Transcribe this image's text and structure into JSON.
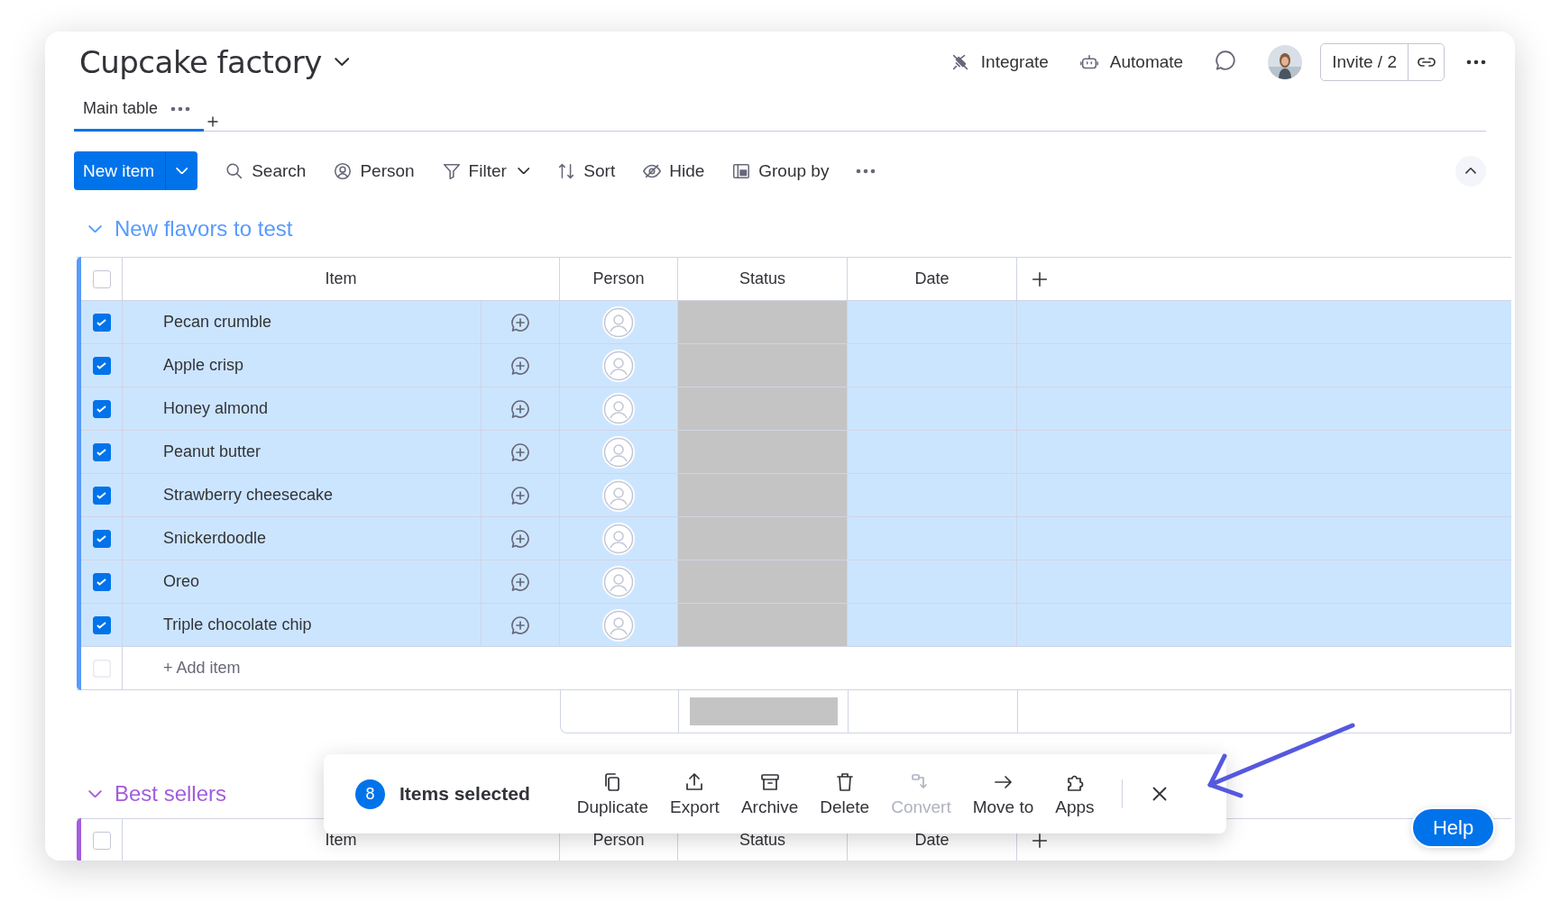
{
  "board": {
    "title": "Cupcake factory"
  },
  "header_actions": [
    {
      "kind": "integrate",
      "label": "Integrate"
    },
    {
      "kind": "automate",
      "label": "Automate"
    }
  ],
  "invite": "Invite / 2",
  "views": [
    {
      "label": "Main table",
      "selected": true
    }
  ],
  "toolbar": {
    "primary": "New item",
    "tools": [
      {
        "kind": "search",
        "label": "Search"
      },
      {
        "kind": "person",
        "label": "Person"
      },
      {
        "kind": "filter",
        "label": "Filter"
      },
      {
        "kind": "sort",
        "label": "Sort"
      },
      {
        "kind": "hide",
        "label": "Hide"
      },
      {
        "kind": "group",
        "label": "Group by"
      }
    ]
  },
  "groups": [
    {
      "title": "New flavors to test",
      "color": "#579bfc",
      "all_checked": false,
      "columns": [
        "Item",
        "Person",
        "Status",
        "Date"
      ],
      "rows": [
        {
          "name": "Pecan crumble",
          "checked": true
        },
        {
          "name": "Apple crisp",
          "checked": true
        },
        {
          "name": "Honey almond",
          "checked": true
        },
        {
          "name": "Peanut butter",
          "checked": true
        },
        {
          "name": "Strawberry cheesecake",
          "checked": true
        },
        {
          "name": "Snickerdoodle",
          "checked": true
        },
        {
          "name": "Oreo",
          "checked": true
        },
        {
          "name": "Triple chocolate chip",
          "checked": true
        }
      ],
      "add_item": "+ Add item"
    },
    {
      "title": "Best sellers",
      "color": "#a25ddc",
      "all_checked": false,
      "columns": [
        "Item",
        "Person",
        "Status",
        "Date"
      ]
    }
  ],
  "selection_bar": {
    "count": "8",
    "label": "Items selected",
    "actions": [
      {
        "kind": "duplicate",
        "label": "Duplicate",
        "disabled": false
      },
      {
        "kind": "export",
        "label": "Export",
        "disabled": false
      },
      {
        "kind": "archive",
        "label": "Archive",
        "disabled": false
      },
      {
        "kind": "delete",
        "label": "Delete",
        "disabled": false
      },
      {
        "kind": "convert",
        "label": "Convert",
        "disabled": true
      },
      {
        "kind": "move",
        "label": "Move to",
        "disabled": false
      },
      {
        "kind": "apps",
        "label": "Apps",
        "disabled": false
      }
    ]
  },
  "help": "Help"
}
